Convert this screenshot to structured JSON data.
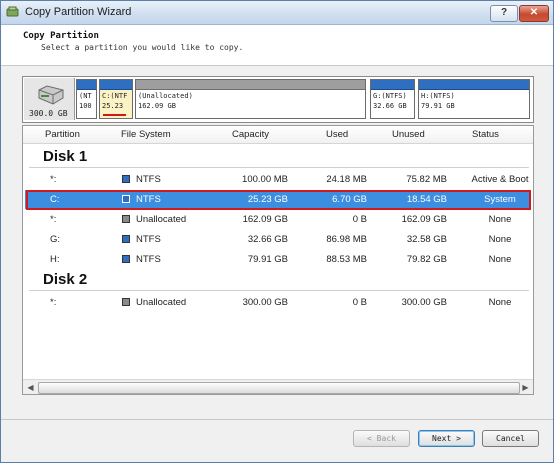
{
  "window": {
    "title": "Copy Partition Wizard",
    "help_label": "?",
    "close_label": "✕"
  },
  "header": {
    "title": "Copy Partition",
    "subtitle": "Select a partition you would like to copy."
  },
  "disk_map": {
    "disk_size": "300.0 GB",
    "cells": [
      {
        "l1": "(NT",
        "l2": "100",
        "bar": "blue"
      },
      {
        "l1": "C:(NTF",
        "l2": "25.23",
        "bar": "blue",
        "selected": true
      },
      {
        "l1": "(Unallocated)",
        "l2": "162.09 GB",
        "bar": "gray"
      },
      {
        "l1": "G:(NTFS)",
        "l2": "32.66 GB",
        "bar": "blue"
      },
      {
        "l1": "H:(NTFS)",
        "l2": "79.91 GB",
        "bar": "blue"
      }
    ]
  },
  "table": {
    "columns": [
      "Partition",
      "File System",
      "Capacity",
      "Used",
      "Unused",
      "Status"
    ],
    "disks": [
      {
        "name": "Disk 1",
        "rows": [
          {
            "partition": "*:",
            "fs": "NTFS",
            "fs_color": "#2f6fc2",
            "capacity": "100.00 MB",
            "used": "24.18 MB",
            "unused": "75.82 MB",
            "status": "Active & Boot"
          },
          {
            "partition": "C:",
            "fs": "NTFS",
            "fs_color": "#2f6fc2",
            "capacity": "25.23 GB",
            "used": "6.70 GB",
            "unused": "18.54 GB",
            "status": "System",
            "selected": true
          },
          {
            "partition": "*:",
            "fs": "Unallocated",
            "fs_color": "#8a8a8a",
            "capacity": "162.09 GB",
            "used": "0 B",
            "unused": "162.09 GB",
            "status": "None"
          },
          {
            "partition": "G:",
            "fs": "NTFS",
            "fs_color": "#2f6fc2",
            "capacity": "32.66 GB",
            "used": "86.98 MB",
            "unused": "32.58 GB",
            "status": "None"
          },
          {
            "partition": "H:",
            "fs": "NTFS",
            "fs_color": "#2f6fc2",
            "capacity": "79.91 GB",
            "used": "88.53 MB",
            "unused": "79.82 GB",
            "status": "None"
          }
        ]
      },
      {
        "name": "Disk 2",
        "rows": [
          {
            "partition": "*:",
            "fs": "Unallocated",
            "fs_color": "#8a8a8a",
            "capacity": "300.00 GB",
            "used": "0 B",
            "unused": "300.00 GB",
            "status": "None"
          }
        ]
      }
    ]
  },
  "buttons": {
    "back": "< Back",
    "next": "Next >",
    "cancel": "Cancel"
  },
  "colors": {
    "selection": "#3b8ee0",
    "highlight_frame": "#d11a1a",
    "ntfs": "#2f6fc2",
    "unallocated": "#8a8a8a"
  }
}
